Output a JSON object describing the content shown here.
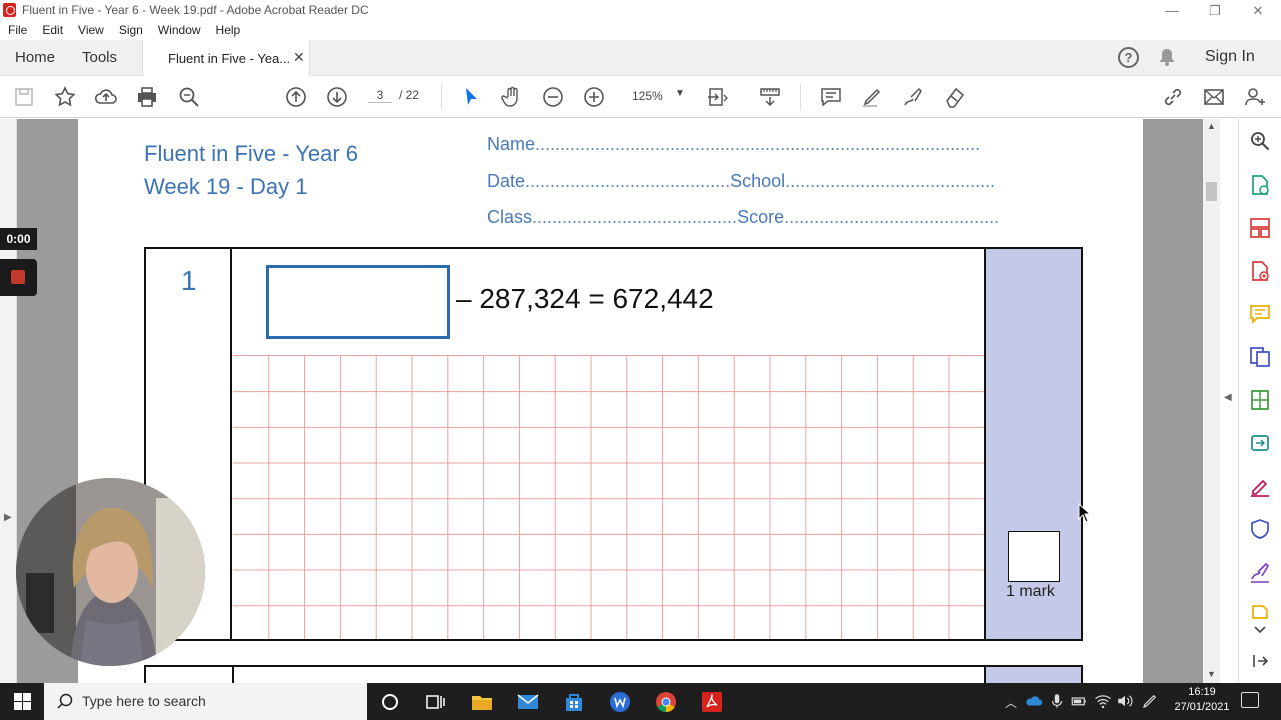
{
  "window": {
    "title": "Fluent in Five - Year 6 - Week 19.pdf - Adobe Acrobat Reader DC"
  },
  "menu": [
    "File",
    "Edit",
    "View",
    "Sign",
    "Window",
    "Help"
  ],
  "tabs": {
    "home": "Home",
    "tools": "Tools",
    "document": "Fluent in Five - Yea...",
    "close": "✕",
    "sign_in": "Sign In"
  },
  "toolbar": {
    "page_current": "3",
    "page_total": "/ 22",
    "zoom": "125%"
  },
  "document": {
    "heading_line1": "Fluent in Five - Year 6",
    "heading_line2": "Week 19 - Day 1",
    "name_label": "Name",
    "date_label": "Date",
    "school_label": "School",
    "class_label": "Class",
    "score_label": "Score",
    "question_number": "1",
    "equation": "– 287,324 = 672,442",
    "mark_label": "1 mark"
  },
  "recording": {
    "timer": "0:00"
  },
  "taskbar": {
    "search_placeholder": "Type here to search",
    "time": "16:19",
    "date": "27/01/2021"
  },
  "colors": {
    "accent_blue": "#3b73b5",
    "mark_column": "#c5c9e8",
    "grid_lines": "#e8a0a0",
    "acrobat_red": "#d7231e"
  }
}
